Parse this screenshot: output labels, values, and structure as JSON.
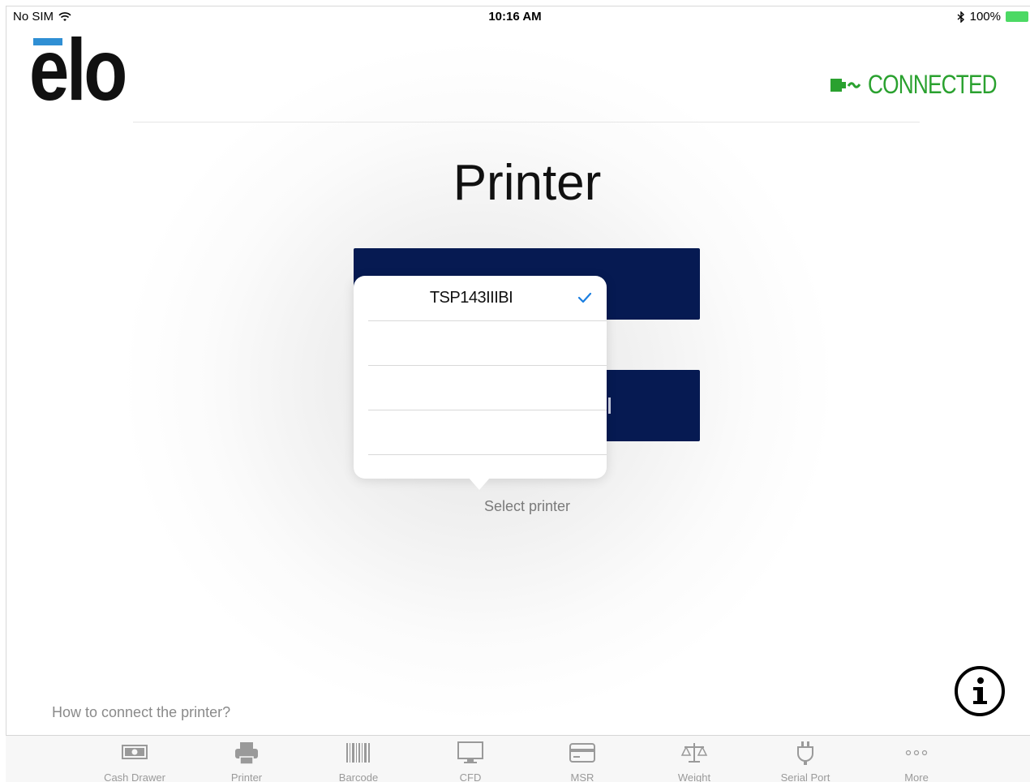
{
  "status_bar": {
    "carrier": "No SIM",
    "time": "10:16 AM",
    "battery": "100%"
  },
  "header": {
    "logo_text": "elo",
    "connection_status": "CONNECTED"
  },
  "page": {
    "title": "Printer"
  },
  "printer_popover": {
    "items": [
      {
        "label": "TSP143IIIBI",
        "selected": true
      },
      {
        "label": ""
      },
      {
        "label": ""
      },
      {
        "label": ""
      }
    ]
  },
  "select_label": "Select printer",
  "help_link": "How to connect the printer?",
  "tabbar": {
    "tabs": [
      {
        "label": "Cash Drawer",
        "icon": "cash-drawer-icon"
      },
      {
        "label": "Printer",
        "icon": "printer-icon"
      },
      {
        "label": "Barcode",
        "icon": "barcode-icon"
      },
      {
        "label": "CFD",
        "icon": "monitor-icon"
      },
      {
        "label": "MSR",
        "icon": "card-icon"
      },
      {
        "label": "Weight",
        "icon": "scale-icon"
      },
      {
        "label": "Serial Port",
        "icon": "plug-icon"
      },
      {
        "label": "More",
        "icon": "more-icon"
      }
    ]
  },
  "colors": {
    "navy": "#061a52",
    "connected_green": "#2aa12f",
    "logo_blue": "#2f8fd4",
    "check_blue": "#1a7ee0"
  }
}
